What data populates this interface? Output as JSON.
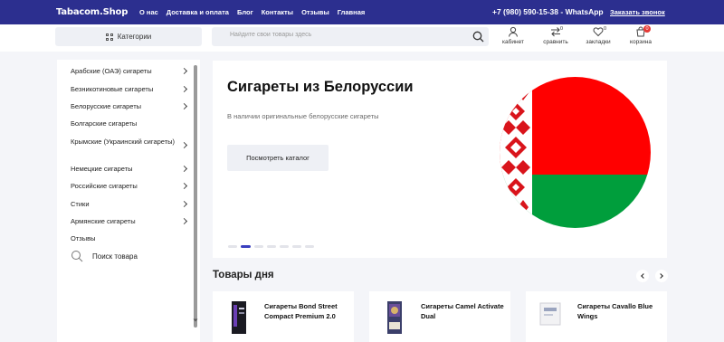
{
  "header": {
    "logo": "Tabacom.Shop",
    "nav": [
      "О нас",
      "Доставка и оплата",
      "Блог",
      "Контакты",
      "Отзывы",
      "Главная"
    ],
    "phone": "+7 (980) 590-15-38 - WhatsApp",
    "callback": "Заказать звонок"
  },
  "toolbar": {
    "categories_label": "Категории",
    "search_placeholder": "Найдите свои товары здесь",
    "icons": [
      {
        "name": "user-icon",
        "label": "кабинет",
        "count": ""
      },
      {
        "name": "compare-icon",
        "label": "сравнить",
        "count": "0"
      },
      {
        "name": "heart-icon",
        "label": "закладки",
        "count": "0"
      },
      {
        "name": "cart-icon",
        "label": "корзина",
        "count": "0"
      }
    ]
  },
  "sidebar": {
    "items": [
      {
        "label": "Арабские (ОАЭ) сигареты",
        "has_arrow": true
      },
      {
        "label": "Безникотиновые сигареты",
        "has_arrow": true
      },
      {
        "label": "Белорусские сигареты",
        "has_arrow": true
      },
      {
        "label": "Болгарские сигареты",
        "has_arrow": false
      },
      {
        "label": "Крымские (Украинский сигареты)",
        "has_arrow": true
      },
      {
        "label": "Немецкие сигареты",
        "has_arrow": true
      },
      {
        "label": "Российские сигареты",
        "has_arrow": true
      },
      {
        "label": "Стики",
        "has_arrow": true
      },
      {
        "label": "Армянские сигареты",
        "has_arrow": true
      },
      {
        "label": "Отзывы",
        "has_arrow": false
      }
    ],
    "search_product": "Поиск товара"
  },
  "hero": {
    "title": "Сигареты из Белоруссии",
    "subtitle": "В наличии оригинальные белорусские сигареты",
    "button": "Посмотреть каталог",
    "slides_total": 7,
    "slide_active": 2,
    "colors": {
      "red": "#ff0000",
      "green": "#009e3c",
      "ornament": "#ffffff"
    }
  },
  "products": {
    "title": "Товары дня",
    "items": [
      {
        "name": "Сигареты Bond Street Compact Premium 2.0"
      },
      {
        "name": "Сигареты Camel Activate Dual"
      },
      {
        "name": "Сигареты Cavallo Blue Wings"
      }
    ]
  },
  "colors": {
    "header_bg": "#2c2f8f",
    "accent": "#3a3fbf",
    "page_bg": "#f4f5f9"
  }
}
